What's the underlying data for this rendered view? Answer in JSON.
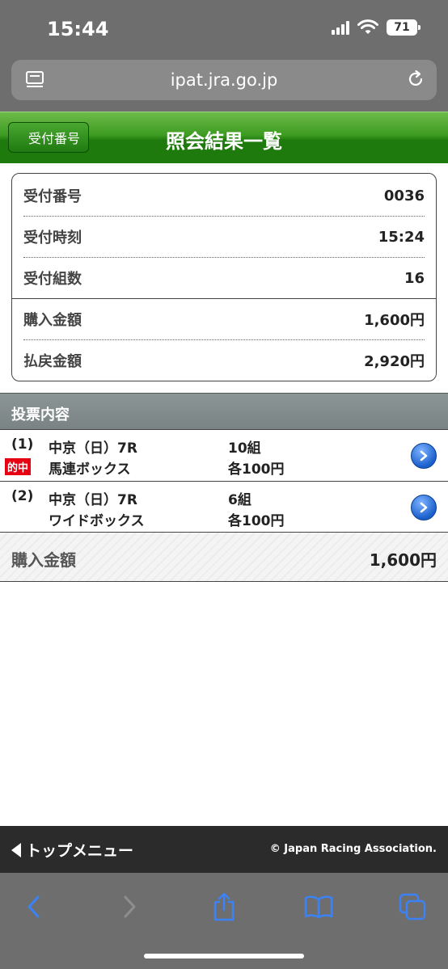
{
  "status_bar": {
    "time": "15:44",
    "battery": "71"
  },
  "browser": {
    "url": "ipat.jra.go.jp"
  },
  "header": {
    "back_label": "受付番号",
    "title": "照会結果一覧"
  },
  "summary": {
    "receipt_no_label": "受付番号",
    "receipt_no": "0036",
    "receipt_time_label": "受付時刻",
    "receipt_time": "15:24",
    "combos_label": "受付組数",
    "combos": "16",
    "purchase_label": "購入金額",
    "purchase": "1,600円",
    "payout_label": "払戻金額",
    "payout": "2,920円"
  },
  "section": {
    "title": "投票内容"
  },
  "bets": [
    {
      "num": "(1)",
      "race": "中京（日）7R",
      "type": "馬連ボックス",
      "count": "10組",
      "unit": "各100円",
      "badge": "的中"
    },
    {
      "num": "(2)",
      "race": "中京（日）7R",
      "type": "ワイドボックス",
      "count": "6組",
      "unit": "各100円",
      "badge": ""
    }
  ],
  "total": {
    "label": "購入金額",
    "value": "1,600円"
  },
  "footer": {
    "menu_label": "トップメニュー",
    "copyright": "© Japan Racing Association."
  },
  "colors": {
    "header_green": "#2e8c17",
    "hit_red": "#e60012",
    "safari_blue": "#3b82f6"
  }
}
